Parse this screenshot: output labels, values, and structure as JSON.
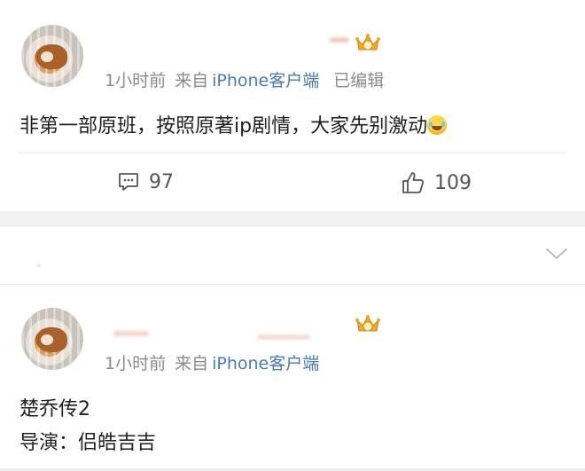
{
  "post1": {
    "time": "1小时前",
    "from_label": "来自",
    "source": "iPhone客户端",
    "edited": "已编辑",
    "text": "非第一部原班，按照原著ip剧情，大家先别激动",
    "comments_count": "97",
    "likes_count": "109",
    "icons": {
      "comment": "comment-icon",
      "like": "thumbs-up-icon",
      "badge": "crown-badge-icon",
      "emoji": "laugh-cry-emoji-icon"
    }
  },
  "collapsed": {
    "icons": {
      "expand": "chevron-down-icon"
    }
  },
  "post2": {
    "time": "1小时前",
    "from_label": "来自",
    "source": "iPhone客户端",
    "line1": "楚乔传2",
    "line2": "导演：侣皓吉吉",
    "icons": {
      "badge": "crown-badge-icon"
    }
  },
  "colors": {
    "source_link": "#4a7ab5",
    "meta_gray": "#8a8a8a",
    "separator": "#f2f2f2"
  }
}
